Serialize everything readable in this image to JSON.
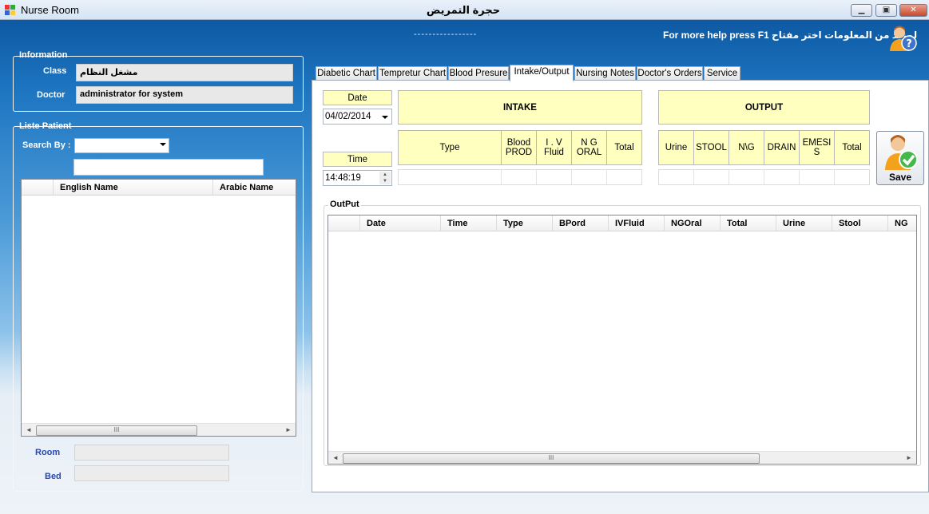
{
  "window": {
    "title": "Nurse Room",
    "title_arabic": "حجرة التمريض",
    "min_label": "▭",
    "max_label": "▣",
    "close_label": "✕"
  },
  "help": {
    "dashes": "-----------------",
    "text": "For more help press  F1  لمزيد من المعلومات اختر مفتاح"
  },
  "information": {
    "title": "Information",
    "class_label": "Class",
    "class_value": "مشغل النظام",
    "doctor_label": "Doctor",
    "doctor_value": "administrator for system"
  },
  "patients": {
    "title": "Liste Patient",
    "search_by_label": "Search By :",
    "search_by_value": "",
    "search_text": "",
    "columns": [
      "",
      "English Name",
      "Arabic Name"
    ],
    "scroll_thumb": "III",
    "room_label": "Room",
    "bed_label": "Bed",
    "room_value": "",
    "bed_value": ""
  },
  "tabs": [
    "Diabetic Chart",
    "Tempretur Chart",
    "Blood Presure",
    "Intake/Output",
    "Nursing Notes",
    "Doctor's Orders",
    "Service"
  ],
  "selected_tab": "Intake/Output",
  "entry": {
    "date_label": "Date",
    "date_value": "04/02/2014",
    "time_label": "Time",
    "time_value": "14:48:19",
    "intake_title": "INTAKE",
    "output_title": "OUTPUT",
    "intake_columns": [
      "Type",
      "Blood PROD",
      "I . V Fluid",
      "N G ORAL",
      "Total"
    ],
    "output_columns": [
      "Urine",
      "STOOL",
      "N\\G",
      "DRAIN",
      "EMESI S",
      "Total"
    ],
    "save_label": "Save"
  },
  "output_grid": {
    "title": "OutPut",
    "columns": [
      "Date",
      "Time",
      "Type",
      "BPord",
      "IVFluid",
      "NGOral",
      "Total",
      "Urine",
      "Stool",
      "NG"
    ],
    "scroll_thumb": "III"
  },
  "colors": {
    "accent_blue": "#1e76c1",
    "yellow_header": "#ffffc0",
    "dim_label": "#2747b8"
  }
}
